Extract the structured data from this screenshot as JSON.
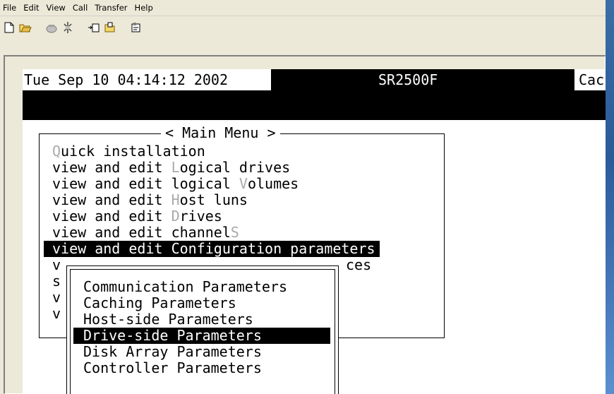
{
  "menubar": {
    "items": [
      "File",
      "Edit",
      "View",
      "Call",
      "Transfer",
      "Help"
    ]
  },
  "toolbar": {
    "icons": [
      "new-icon",
      "open-icon",
      "phone-icon",
      "disconnect-icon",
      "send-icon",
      "receive-icon",
      "properties-icon"
    ]
  },
  "terminal": {
    "date": "Tue Sep 10 04:14:12 2002",
    "model": "SR2500F",
    "cache": "Cach",
    "main_menu_title": "< Main Menu >",
    "main_menu": [
      {
        "pre": "",
        "hot": "Q",
        "post": "uick installation"
      },
      {
        "pre": "view and edit ",
        "hot": "L",
        "post": "ogical drives"
      },
      {
        "pre": "view and edit logical ",
        "hot": "V",
        "post": "olumes"
      },
      {
        "pre": "view and edit ",
        "hot": "H",
        "post": "ost luns"
      },
      {
        "pre": "view and edit ",
        "hot": "D",
        "post": "rives"
      },
      {
        "pre": "view and edit channel",
        "hot": "S",
        "post": ""
      },
      {
        "pre": "view and edit Configuration parameters",
        "hot": "",
        "post": ""
      }
    ],
    "obscured_rows": [
      {
        "left": "v",
        "right": "ces"
      },
      {
        "left": "s",
        "right": ""
      },
      {
        "left": "v",
        "right": ""
      },
      {
        "left": "v",
        "right": ""
      }
    ],
    "submenu": [
      "Communication Parameters",
      "Caching Parameters",
      "Host-side Parameters",
      "Drive-side Parameters",
      "Disk Array Parameters",
      "Controller Parameters"
    ],
    "selected_submenu_index": 3
  }
}
